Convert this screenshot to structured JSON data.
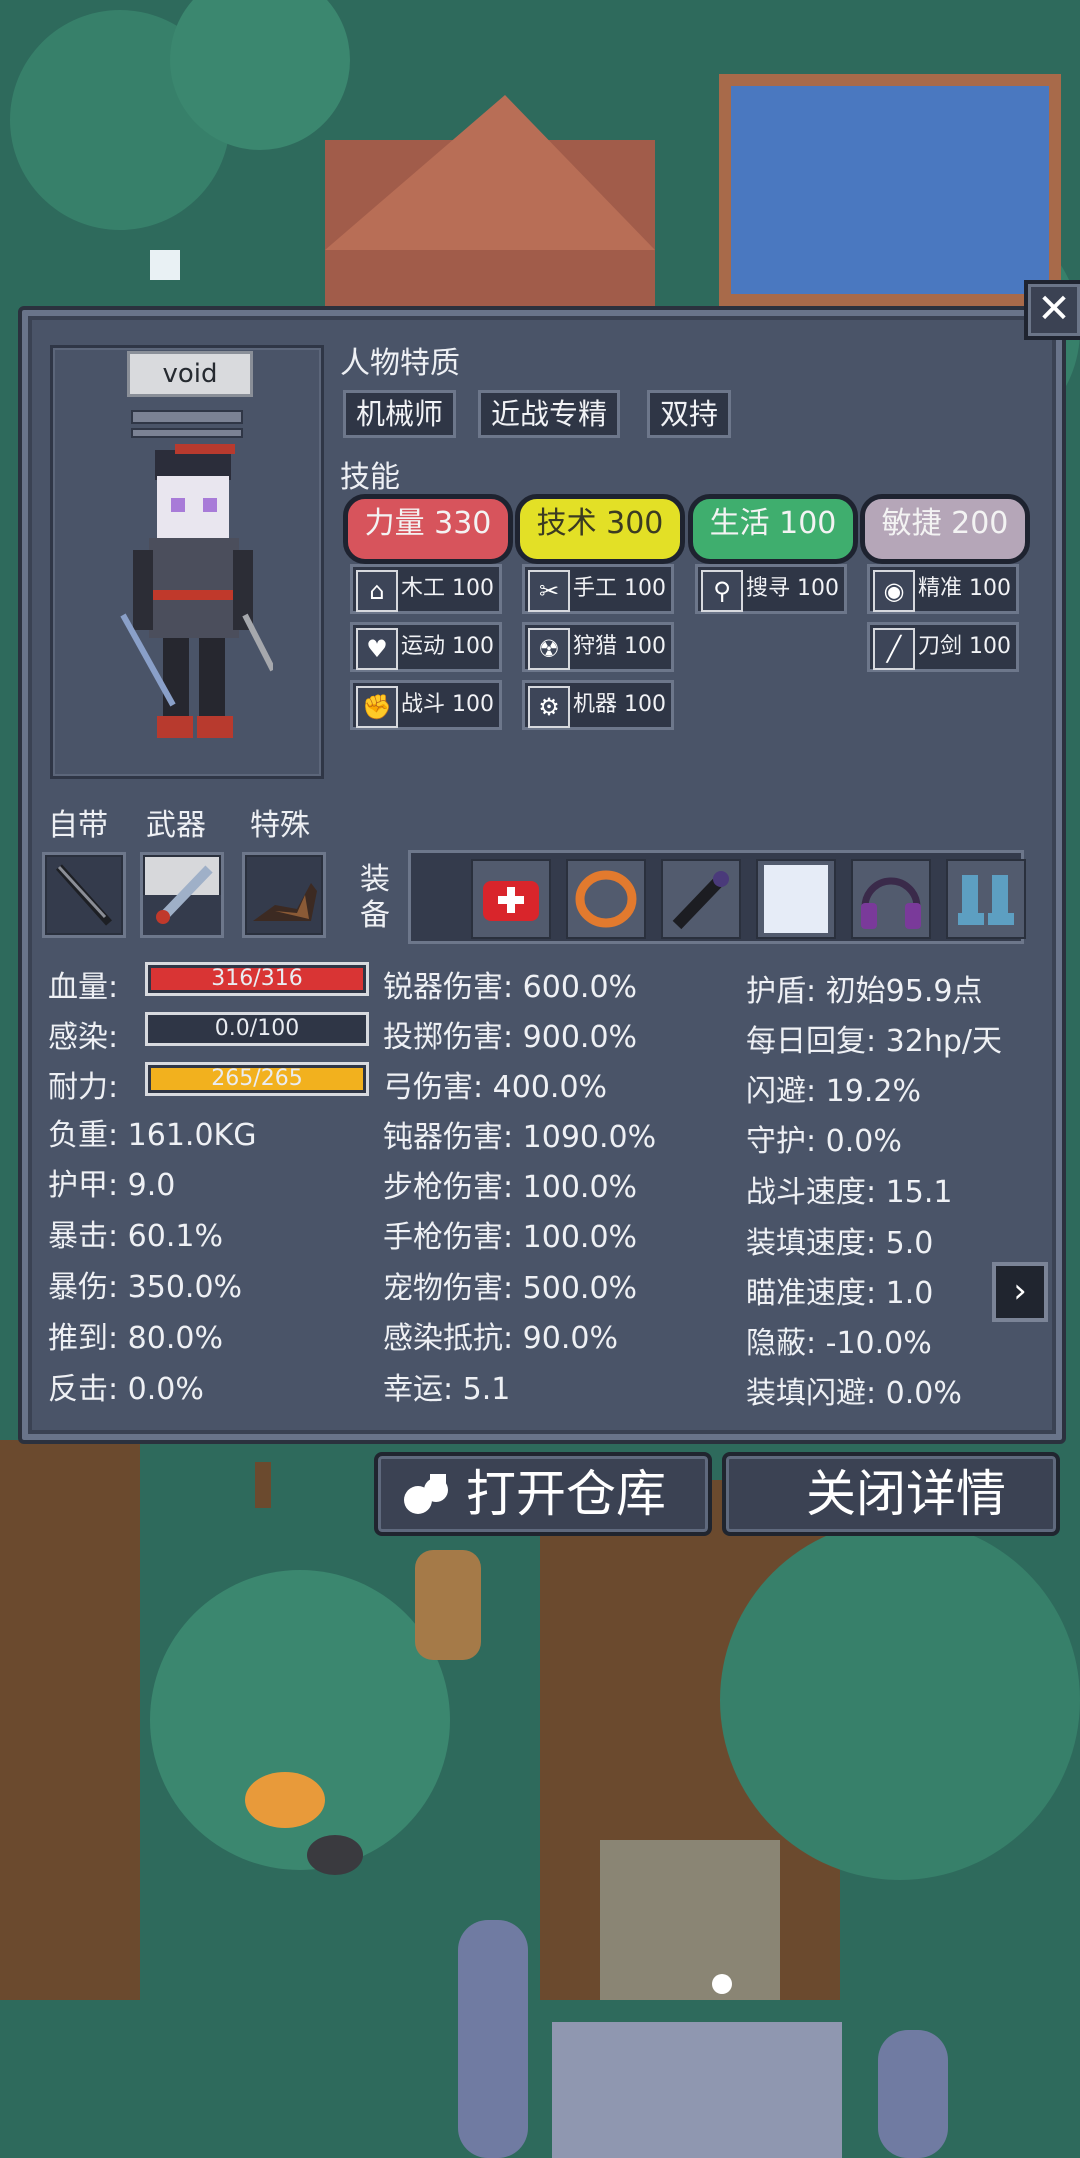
{
  "character": {
    "name": "void"
  },
  "traits": {
    "title": "人物特质",
    "items": [
      "机械师",
      "近战专精",
      "双持"
    ]
  },
  "skills": {
    "title": "技能",
    "categories": [
      {
        "label": "力量 330",
        "color": "#d7545c"
      },
      {
        "label": "技术 300",
        "color": "#e3e026"
      },
      {
        "label": "生活 100",
        "color": "#3fae6e"
      },
      {
        "label": "敏捷 200",
        "color": "#b5a6b8"
      }
    ],
    "strength": [
      {
        "icon": "house-icon",
        "glyph": "⌂",
        "label": "木工 100"
      },
      {
        "icon": "heart-icon",
        "glyph": "♥",
        "label": "运动 100"
      },
      {
        "icon": "fist-icon",
        "glyph": "✊",
        "label": "战斗 100"
      }
    ],
    "tech": [
      {
        "icon": "scissors-icon",
        "glyph": "✂",
        "label": "手工 100"
      },
      {
        "icon": "radiation-icon",
        "glyph": "☢",
        "label": "狩猎 100"
      },
      {
        "icon": "gear-icon",
        "glyph": "⚙",
        "label": "机器 100"
      }
    ],
    "life": [
      {
        "icon": "magnifier-icon",
        "glyph": "⚲",
        "label": "搜寻 100"
      }
    ],
    "agility": [
      {
        "icon": "eye-icon",
        "glyph": "◉",
        "label": "精准 100"
      },
      {
        "icon": "blade-icon",
        "glyph": "╱",
        "label": "刀剑 100"
      }
    ]
  },
  "slots": {
    "labels": [
      "自带",
      "武器",
      "特殊"
    ]
  },
  "equipment": {
    "label_top": "装",
    "label_bottom": "备"
  },
  "bars": {
    "hp": {
      "label": "血量:",
      "text": "316/316",
      "fraction": 1.0,
      "color": "#d93434"
    },
    "infection": {
      "label": "感染:",
      "text": "0.0/100",
      "fraction": 0.0,
      "color": "#7a8192"
    },
    "stamina": {
      "label": "耐力:",
      "text": "265/265",
      "fraction": 1.0,
      "color": "#f2b11e"
    }
  },
  "stats_left": [
    "负重: 161.0KG",
    "护甲: 9.0",
    "暴击: 60.1%",
    "暴伤: 350.0%",
    "推到: 80.0%",
    "反击: 0.0%"
  ],
  "stats_mid": [
    "锐器伤害: 600.0%",
    "投掷伤害: 900.0%",
    "弓伤害: 400.0%",
    "钝器伤害: 1090.0%",
    "步枪伤害: 100.0%",
    "手枪伤害: 100.0%",
    "宠物伤害: 500.0%",
    "感染抵抗: 90.0%",
    "幸运: 5.1"
  ],
  "stats_right": [
    "护盾: 初始95.9点",
    "每日回复: 32hp/天",
    "闪避: 19.2%",
    "守护: 0.0%",
    "战斗速度: 15.1",
    "装填速度: 5.0",
    "瞄准速度: 1.0",
    "隐蔽: -10.0%",
    "装填闪避: 0.0%"
  ],
  "buttons": {
    "open_storage": "打开仓库",
    "close_details": "关闭详情"
  }
}
